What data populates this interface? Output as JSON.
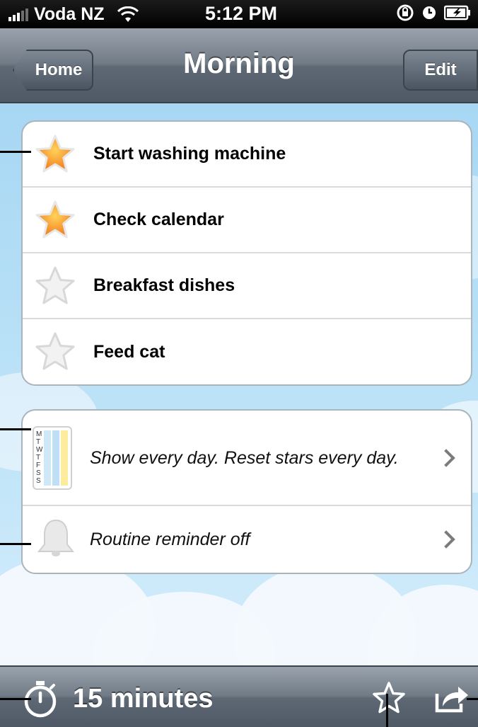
{
  "status_bar": {
    "carrier": "Voda NZ",
    "time": "5:12 PM"
  },
  "nav": {
    "back_label": "Home",
    "title": "Morning",
    "edit_label": "Edit"
  },
  "tasks": [
    {
      "label": "Start washing machine",
      "starred": true
    },
    {
      "label": "Check calendar",
      "starred": true
    },
    {
      "label": "Breakfast dishes",
      "starred": false
    },
    {
      "label": "Feed cat",
      "starred": false
    }
  ],
  "settings": {
    "schedule_text": "Show every day. Reset stars every day.",
    "calendar_letters": "MTWTFSS",
    "reminder_text": "Routine reminder off"
  },
  "toolbar": {
    "duration_label": "15 minutes"
  },
  "icons": {
    "star_active": "star-icon-orange",
    "star_inactive": "star-icon-gray",
    "calendar": "calendar-icon",
    "bell": "bell-icon",
    "timer": "stopwatch-icon",
    "favorite": "star-outline-icon",
    "share": "share-icon"
  },
  "colors": {
    "star_active": "#f7922a",
    "star_inactive": "#eeeeee",
    "nav_bar": "#6f7985",
    "sky": "#a7d7f3"
  }
}
